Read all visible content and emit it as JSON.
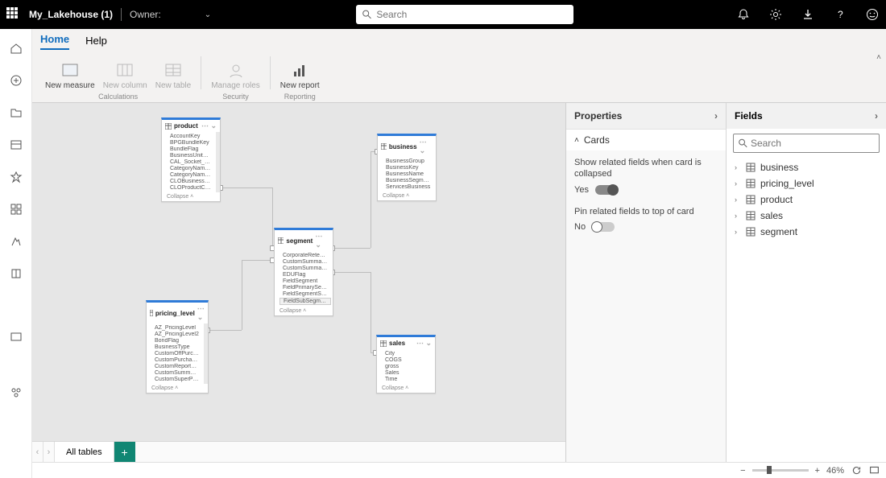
{
  "topbar": {
    "title": "My_Lakehouse (1)",
    "owner_label": "Owner:",
    "search_placeholder": "Search"
  },
  "tabs": {
    "home": "Home",
    "help": "Help"
  },
  "ribbon": {
    "new_measure": "New measure",
    "new_column": "New column",
    "new_table": "New table",
    "manage_roles": "Manage roles",
    "new_report": "New report",
    "grp_calc": "Calculations",
    "grp_sec": "Security",
    "grp_rep": "Reporting"
  },
  "tables": {
    "product": {
      "name": "product",
      "fields": [
        "AccountKey",
        "BPGBundleKey",
        "BundleFlag",
        "BusinessUnitName",
        "CAL_Socket_Flag",
        "CategoryNameCRMField",
        "CategoryNameDetail",
        "CLOBusinessUnit",
        "CLOProductCombinedServices"
      ],
      "collapse": "Collapse ˄"
    },
    "business": {
      "name": "business",
      "fields": [
        "BusinessGroup",
        "BusinessKey",
        "BusinessName",
        "BusinessSegmentName",
        "ServicesBusiness"
      ],
      "collapse": "Collapse ˄"
    },
    "segment": {
      "name": "segment",
      "fields": [
        "CorporateRetentionFlag",
        "CustomSummarySector",
        "CustomSummarySegment",
        "EDUFlag",
        "FieldSegment",
        "FieldPrimarySegment",
        "FieldSegmentSort",
        "FieldSubSegment"
      ],
      "collapse": "Collapse ˄"
    },
    "pricing_level": {
      "name": "pricing_level",
      "fields": [
        "AZ_PricingLevel",
        "AZ_PricingLevel2",
        "BondFlag",
        "BusinessType",
        "CustomOffPurchaseType",
        "CustomPurchaseType",
        "CustomReportSummaryRateType",
        "CustomSummaryPurchaseType",
        "CustomSuperPricingLevel"
      ],
      "collapse": "Collapse ˄"
    },
    "sales": {
      "name": "sales",
      "fields": [
        "City",
        "COGS",
        "gross",
        "Sales",
        "Time"
      ],
      "collapse": "Collapse ˄"
    }
  },
  "tabbar": {
    "sheet": "All tables"
  },
  "properties": {
    "title": "Properties",
    "section": "Cards",
    "opt1": "Show related fields when card is collapsed",
    "opt1_state": "Yes",
    "opt2": "Pin related fields to top of card",
    "opt2_state": "No"
  },
  "fields_pane": {
    "title": "Fields",
    "search_placeholder": "Search",
    "items": [
      "business",
      "pricing_level",
      "product",
      "sales",
      "segment"
    ]
  },
  "status": {
    "zoom": "46%"
  }
}
